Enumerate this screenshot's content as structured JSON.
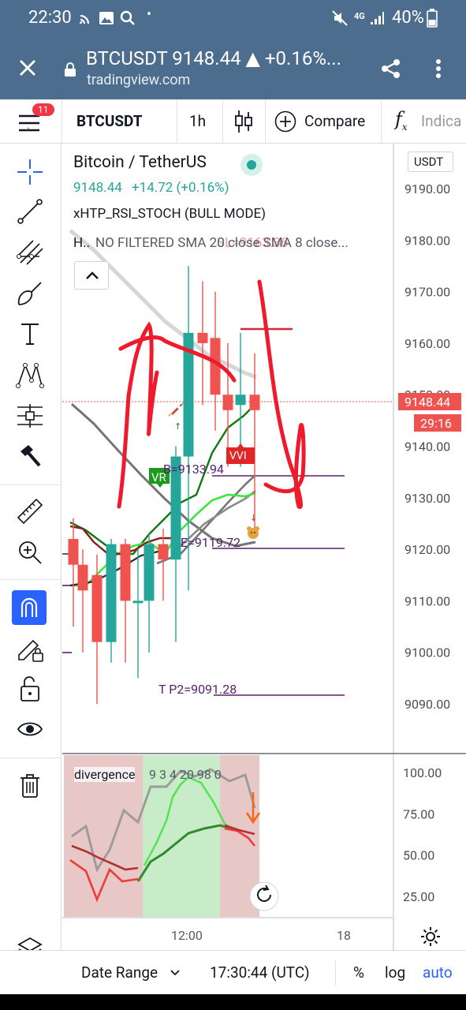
{
  "status": {
    "time": "22:30",
    "network": "4G",
    "battery": "40%"
  },
  "browser": {
    "title": "BTCUSDT 9148.44 ▲ +0.16%...",
    "url": "tradingview.com"
  },
  "toolbar": {
    "badge": "11",
    "symbol": "BTCUSDT",
    "interval": "1h",
    "compare": "Compare",
    "indicators": "Indica"
  },
  "legend": {
    "pair": "Bitcoin / TetherUS",
    "price": "9148.44",
    "change": "+14.72 (+0.16%)",
    "study1": "xHTP_RSI_STOCH (BULL MODE)",
    "study2_prefix": "H..",
    "study2": "NO FILTERED SMA 20 close SMA 8 close...",
    "overlap_text": "SL=9163.36"
  },
  "price_axis": {
    "currency": "USDT",
    "ticks": [
      "9190.00",
      "9180.00",
      "9170.00",
      "9160.00",
      "9150.00",
      "9140.00",
      "9130.00",
      "9120.00",
      "9110.00",
      "9100.00",
      "9090.00"
    ],
    "last_price": "9148.44",
    "countdown": "29:16"
  },
  "annotations": {
    "b_label": "B=9133.94",
    "e_label": "E=9119.72",
    "tp2_label": "T P2=9091.28",
    "vr_tag": "VR",
    "vvi_tag": "VVI"
  },
  "oscillator": {
    "title": "divergence",
    "values": "9 3 4 20 98 0",
    "ticks": [
      "100.00",
      "75.00",
      "50.00",
      "25.00"
    ]
  },
  "time_axis": {
    "ticks": [
      "12:00",
      "18"
    ]
  },
  "bottom": {
    "date_range": "Date Range",
    "clock": "17:30:44 (UTC)",
    "percent": "%",
    "log": "log",
    "auto": "auto"
  },
  "colors": {
    "up": "#26a69a",
    "down": "#ef5350",
    "accent": "#2962ff",
    "header": "#4d6d8f"
  }
}
